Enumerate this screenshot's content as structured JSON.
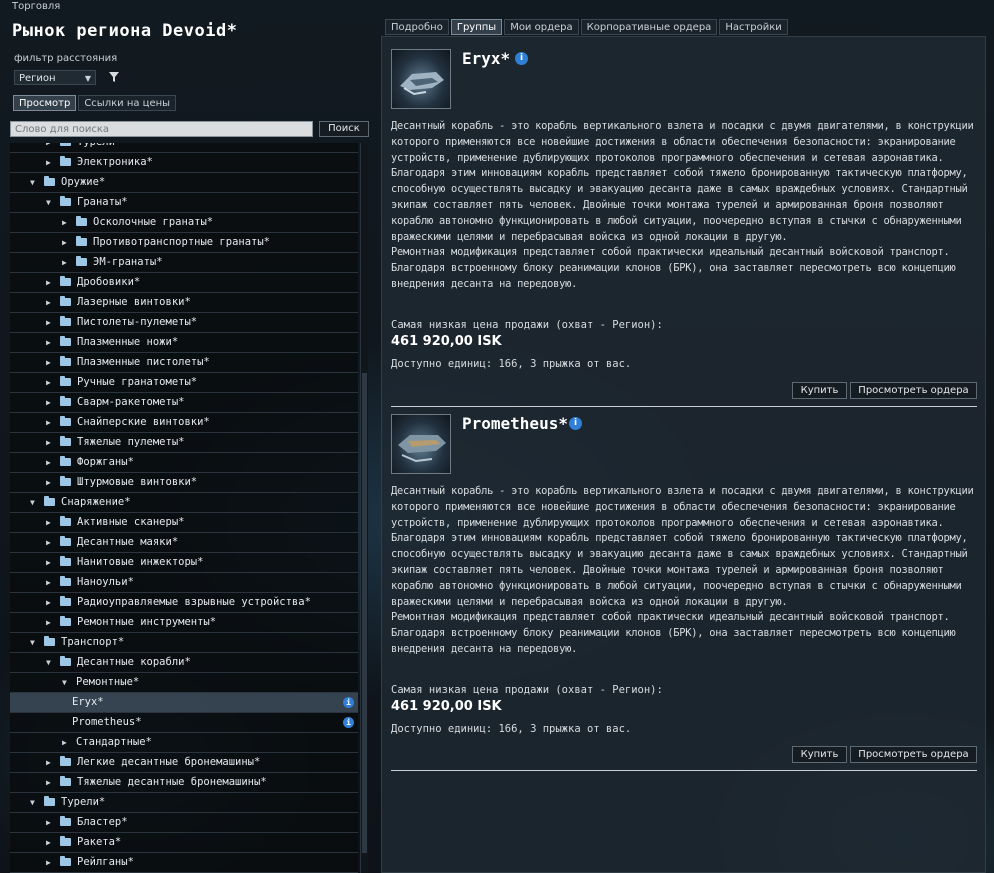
{
  "window": {
    "title": "Торговля"
  },
  "left": {
    "region_title": "Рынок региона Devoid*",
    "filter_label": "фильтр расстояния",
    "filter_select": "Регион",
    "tabs": [
      "Просмотр",
      "Ссылки на цены"
    ],
    "search_placeholder": "Слово для поиска",
    "search_button": "Поиск"
  },
  "tree": [
    {
      "label": "Турели*",
      "indent": 2,
      "type": "collapsed"
    },
    {
      "label": "Электроника*",
      "indent": 2,
      "type": "collapsed"
    },
    {
      "label": "Оружие*",
      "indent": 1,
      "type": "expanded"
    },
    {
      "label": "Гранаты*",
      "indent": 2,
      "type": "expanded"
    },
    {
      "label": "Осколочные гранаты*",
      "indent": 3,
      "type": "collapsed"
    },
    {
      "label": "Противотранспортные гранаты*",
      "indent": 3,
      "type": "collapsed"
    },
    {
      "label": "ЭМ-гранаты*",
      "indent": 3,
      "type": "collapsed"
    },
    {
      "label": "Дробовики*",
      "indent": 2,
      "type": "collapsed"
    },
    {
      "label": "Лазерные винтовки*",
      "indent": 2,
      "type": "collapsed"
    },
    {
      "label": "Пистолеты-пулеметы*",
      "indent": 2,
      "type": "collapsed"
    },
    {
      "label": "Плазменные ножи*",
      "indent": 2,
      "type": "collapsed"
    },
    {
      "label": "Плазменные пистолеты*",
      "indent": 2,
      "type": "collapsed"
    },
    {
      "label": "Ручные гранатометы*",
      "indent": 2,
      "type": "collapsed"
    },
    {
      "label": "Сварм-ракетометы*",
      "indent": 2,
      "type": "collapsed"
    },
    {
      "label": "Снайперские винтовки*",
      "indent": 2,
      "type": "collapsed"
    },
    {
      "label": "Тяжелые пулеметы*",
      "indent": 2,
      "type": "collapsed"
    },
    {
      "label": "Форжганы*",
      "indent": 2,
      "type": "collapsed"
    },
    {
      "label": "Штурмовые винтовки*",
      "indent": 2,
      "type": "collapsed"
    },
    {
      "label": "Снаряжение*",
      "indent": 1,
      "type": "expanded"
    },
    {
      "label": "Активные сканеры*",
      "indent": 2,
      "type": "collapsed"
    },
    {
      "label": "Десантные маяки*",
      "indent": 2,
      "type": "collapsed"
    },
    {
      "label": "Нанитовые инжекторы*",
      "indent": 2,
      "type": "collapsed"
    },
    {
      "label": "Наноульи*",
      "indent": 2,
      "type": "collapsed"
    },
    {
      "label": "Радиоуправляемые взрывные устройства*",
      "indent": 2,
      "type": "collapsed"
    },
    {
      "label": "Ремонтные инструменты*",
      "indent": 2,
      "type": "collapsed"
    },
    {
      "label": "Транспорт*",
      "indent": 1,
      "type": "expanded"
    },
    {
      "label": "Десантные корабли*",
      "indent": 2,
      "type": "expanded"
    },
    {
      "label": "Ремонтные*",
      "indent": 3,
      "type": "expanded-nofolder"
    },
    {
      "label": "Eryx*",
      "indent": 4,
      "type": "leaf",
      "selected": true
    },
    {
      "label": "Prometheus*",
      "indent": 4,
      "type": "leaf"
    },
    {
      "label": "Стандартные*",
      "indent": 3,
      "type": "collapsed-nofolder"
    },
    {
      "label": "Легкие десантные бронемашины*",
      "indent": 2,
      "type": "collapsed"
    },
    {
      "label": "Тяжелые десантные бронемашины*",
      "indent": 2,
      "type": "collapsed"
    },
    {
      "label": "Турели*",
      "indent": 1,
      "type": "expanded"
    },
    {
      "label": "Бластер*",
      "indent": 2,
      "type": "collapsed"
    },
    {
      "label": "Ракета*",
      "indent": 2,
      "type": "collapsed"
    },
    {
      "label": "Рейлганы*",
      "indent": 2,
      "type": "collapsed"
    }
  ],
  "right": {
    "tabs": [
      "Подробно",
      "Группы",
      "Мои ордера",
      "Корпоративные ордера",
      "Настройки"
    ],
    "active_tab": 1
  },
  "items": [
    {
      "name": "Eryx*",
      "description": "Десантный корабль - это корабль вертикального взлета и посадки с двумя двигателями, в конструкции которого применяются все новейшие достижения в области обеспечения безопасности: экранирование устройств, применение дублирующих протоколов программного обеспечения и сетевая аэронавтика.\nБлагодаря этим инновациям корабль представляет собой тяжело бронированную тактическую платформу, способную осуществлять высадку и эвакуацию десанта даже в самых враждебных условиях. Стандартный экипаж составляет пять человек. Двойные точки монтажа турелей и армированная броня позволяют кораблю автономно функционировать в любой ситуации, поочередно вступая в стычки с обнаруженными вражескими целями и перебрасывая войска из одной локации в другую.\nРемонтная модификация представляет собой практически идеальный десантный войсковой транспорт. Благодаря встроенному блоку реанимации клонов (БРК), она заставляет пересмотреть всю концепцию внедрения десанта на передовую.",
      "price_label": "Самая низкая цена продажи (охват - Регион):",
      "price": "461 920,00 ISK",
      "availability": "Доступно единиц: 166, 3 прыжка от вас.",
      "buy_label": "Купить",
      "view_orders_label": "Просмотреть ордера"
    },
    {
      "name": "Prometheus*",
      "description": "Десантный корабль - это корабль вертикального взлета и посадки с двумя двигателями, в конструкции которого применяются все новейшие достижения в области обеспечения безопасности: экранирование устройств, применение дублирующих протоколов программного обеспечения и сетевая аэронавтика.\nБлагодаря этим инновациям корабль представляет собой тяжело бронированную тактическую платформу, способную осуществлять высадку и эвакуацию десанта даже в самых враждебных условиях. Стандартный экипаж составляет пять человек. Двойные точки монтажа турелей и армированная броня позволяют кораблю автономно функционировать в любой ситуации, поочередно вступая в стычки с обнаруженными вражескими целями и перебрасывая войска из одной локации в другую.\nРемонтная модификация представляет собой практически идеальный десантный войсковой транспорт. Благодаря встроенному блоку реанимации клонов (БРК), она заставляет пересмотреть всю концепцию внедрения десанта на передовую.",
      "price_label": "Самая низкая цена продажи (охват - Регион):",
      "price": "461 920,00 ISK",
      "availability": "Доступно единиц: 166, 3 прыжка от вас.",
      "buy_label": "Купить",
      "view_orders_label": "Просмотреть ордера"
    }
  ]
}
